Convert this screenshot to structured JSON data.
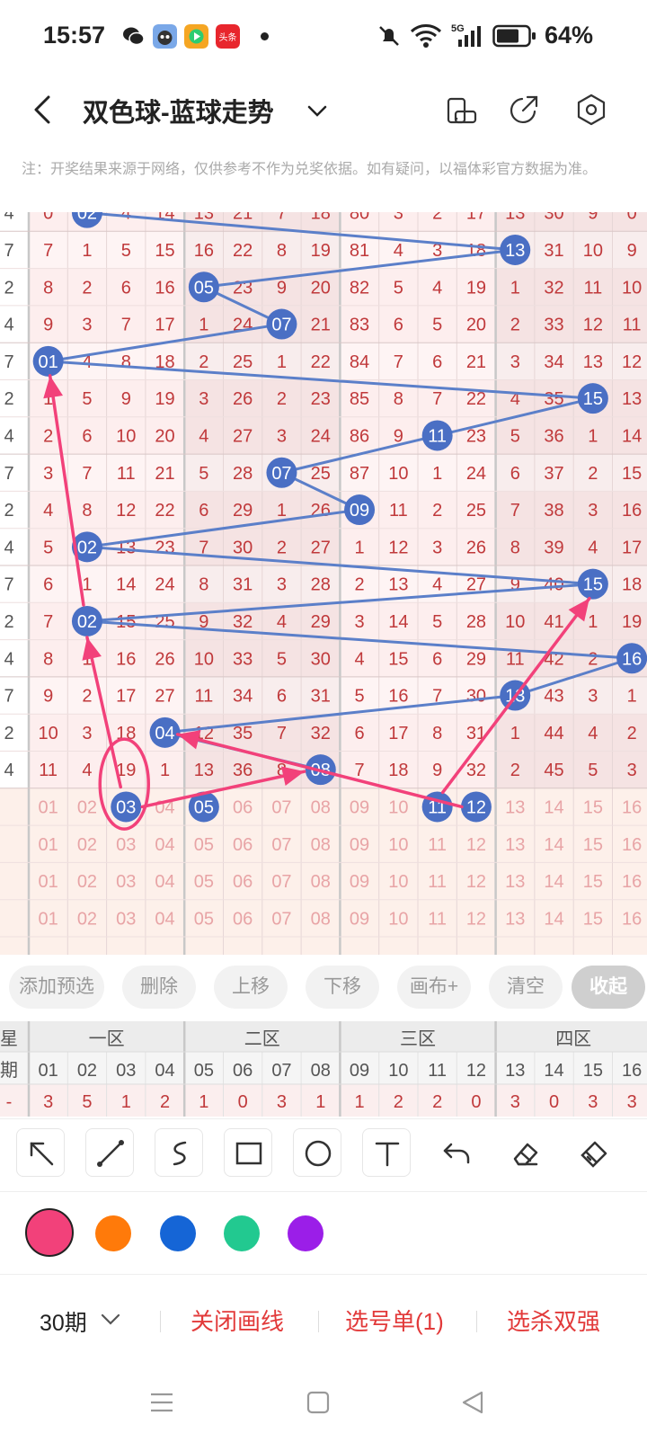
{
  "status_bar": {
    "time": "15:57",
    "app_icons": [
      "wechat-icon",
      "cat-app-icon",
      "video-app-icon",
      "toutiao-icon"
    ],
    "toutiao_text": "头条",
    "net_label": "5G",
    "battery": "64%"
  },
  "header": {
    "title": "双色球-蓝球走势"
  },
  "notice": "注：开奖结果来源于网络，仅供参考不作为兑奖依据。如有疑问，以福体彩官方数据为准。",
  "chart": {
    "left_col": [
      "4",
      "7",
      "2",
      "4",
      "7",
      "2",
      "4",
      "7",
      "2",
      "4",
      "7",
      "2",
      "4",
      "7",
      "2",
      "4"
    ],
    "rows": [
      [
        "0",
        "02",
        "4",
        "14",
        "13",
        "21",
        "7",
        "18",
        "80",
        "3",
        "2",
        "17",
        "13",
        "30",
        "9",
        "0"
      ],
      [
        "7",
        "1",
        "5",
        "15",
        "16",
        "22",
        "8",
        "19",
        "81",
        "4",
        "3",
        "18",
        "13",
        "31",
        "10",
        "9"
      ],
      [
        "8",
        "2",
        "6",
        "16",
        "05",
        "23",
        "9",
        "20",
        "82",
        "5",
        "4",
        "19",
        "1",
        "32",
        "11",
        "10"
      ],
      [
        "9",
        "3",
        "7",
        "17",
        "1",
        "24",
        "07",
        "21",
        "83",
        "6",
        "5",
        "20",
        "2",
        "33",
        "12",
        "11"
      ],
      [
        "01",
        "4",
        "8",
        "18",
        "2",
        "25",
        "1",
        "22",
        "84",
        "7",
        "6",
        "21",
        "3",
        "34",
        "13",
        "12"
      ],
      [
        "1",
        "5",
        "9",
        "19",
        "3",
        "26",
        "2",
        "23",
        "85",
        "8",
        "7",
        "22",
        "4",
        "35",
        "15",
        "13"
      ],
      [
        "2",
        "6",
        "10",
        "20",
        "4",
        "27",
        "3",
        "24",
        "86",
        "9",
        "11",
        "23",
        "5",
        "36",
        "1",
        "14"
      ],
      [
        "3",
        "7",
        "11",
        "21",
        "5",
        "28",
        "07",
        "25",
        "87",
        "10",
        "1",
        "24",
        "6",
        "37",
        "2",
        "15"
      ],
      [
        "4",
        "8",
        "12",
        "22",
        "6",
        "29",
        "1",
        "26",
        "09",
        "11",
        "2",
        "25",
        "7",
        "38",
        "3",
        "16"
      ],
      [
        "5",
        "02",
        "13",
        "23",
        "7",
        "30",
        "2",
        "27",
        "1",
        "12",
        "3",
        "26",
        "8",
        "39",
        "4",
        "17"
      ],
      [
        "6",
        "1",
        "14",
        "24",
        "8",
        "31",
        "3",
        "28",
        "2",
        "13",
        "4",
        "27",
        "9",
        "40",
        "15",
        "18"
      ],
      [
        "7",
        "02",
        "15",
        "25",
        "9",
        "32",
        "4",
        "29",
        "3",
        "14",
        "5",
        "28",
        "10",
        "41",
        "1",
        "19"
      ],
      [
        "8",
        "1",
        "16",
        "26",
        "10",
        "33",
        "5",
        "30",
        "4",
        "15",
        "6",
        "29",
        "11",
        "42",
        "2",
        "16"
      ],
      [
        "9",
        "2",
        "17",
        "27",
        "11",
        "34",
        "6",
        "31",
        "5",
        "16",
        "7",
        "30",
        "13",
        "43",
        "3",
        "1"
      ],
      [
        "10",
        "3",
        "18",
        "04",
        "12",
        "35",
        "7",
        "32",
        "6",
        "17",
        "8",
        "31",
        "1",
        "44",
        "4",
        "2"
      ],
      [
        "11",
        "4",
        "19",
        "1",
        "13",
        "36",
        "8",
        "08",
        "7",
        "18",
        "9",
        "32",
        "2",
        "45",
        "5",
        "3"
      ]
    ],
    "select_rows": [
      [
        "01",
        "02",
        "03",
        "04",
        "05",
        "06",
        "07",
        "08",
        "09",
        "10",
        "11",
        "12",
        "13",
        "14",
        "15",
        "16"
      ],
      [
        "01",
        "02",
        "03",
        "04",
        "05",
        "06",
        "07",
        "08",
        "09",
        "10",
        "11",
        "12",
        "13",
        "14",
        "15",
        "16"
      ],
      [
        "01",
        "02",
        "03",
        "04",
        "05",
        "06",
        "07",
        "08",
        "09",
        "10",
        "11",
        "12",
        "13",
        "14",
        "15",
        "16"
      ],
      [
        "01",
        "02",
        "03",
        "04",
        "05",
        "06",
        "07",
        "08",
        "09",
        "10",
        "11",
        "12",
        "13",
        "14",
        "15",
        "16"
      ]
    ],
    "blue_balls": [
      {
        "row": 0,
        "col": 1
      },
      {
        "row": 1,
        "col": 12
      },
      {
        "row": 2,
        "col": 4
      },
      {
        "row": 3,
        "col": 6
      },
      {
        "row": 4,
        "col": 0
      },
      {
        "row": 5,
        "col": 14
      },
      {
        "row": 6,
        "col": 10
      },
      {
        "row": 7,
        "col": 6
      },
      {
        "row": 8,
        "col": 8
      },
      {
        "row": 9,
        "col": 1
      },
      {
        "row": 10,
        "col": 14
      },
      {
        "row": 11,
        "col": 1
      },
      {
        "row": 12,
        "col": 15
      },
      {
        "row": 13,
        "col": 12
      },
      {
        "row": 14,
        "col": 3
      },
      {
        "row": 15,
        "col": 7
      }
    ],
    "selected_balls": [
      {
        "row": 0,
        "col": 2
      },
      {
        "row": 0,
        "col": 4
      },
      {
        "row": 0,
        "col": 10
      },
      {
        "row": 0,
        "col": 11
      }
    ]
  },
  "actions": {
    "add": "添加预选",
    "delete": "删除",
    "up": "上移",
    "down": "下移",
    "canvas": "画布+",
    "clear": "清空",
    "collapse": "收起"
  },
  "stats": {
    "row1_label": "星",
    "row2_label": "期",
    "row3_label": "-",
    "zones": [
      "一区",
      "二区",
      "三区",
      "四区"
    ],
    "numbers": [
      "01",
      "02",
      "03",
      "04",
      "05",
      "06",
      "07",
      "08",
      "09",
      "10",
      "11",
      "12",
      "13",
      "14",
      "15",
      "16"
    ],
    "counts": [
      "3",
      "5",
      "1",
      "2",
      "1",
      "0",
      "3",
      "1",
      "1",
      "2",
      "2",
      "0",
      "3",
      "0",
      "3",
      "3"
    ]
  },
  "tools": [
    "arrow-tool-icon",
    "line-tool-icon",
    "curve-tool-icon",
    "rect-tool-icon",
    "circle-tool-icon",
    "text-tool-icon",
    "undo-icon",
    "eraser-icon",
    "clear-brush-icon"
  ],
  "colors": [
    "#f2417a",
    "#ff7a0a",
    "#1565d6",
    "#22c990",
    "#9b1ee8"
  ],
  "selected_color": "#f2417a",
  "bottom": {
    "period": "30期",
    "close_line": "关闭画线",
    "pick_list": "选号单(1)",
    "kill": "选杀双强"
  }
}
